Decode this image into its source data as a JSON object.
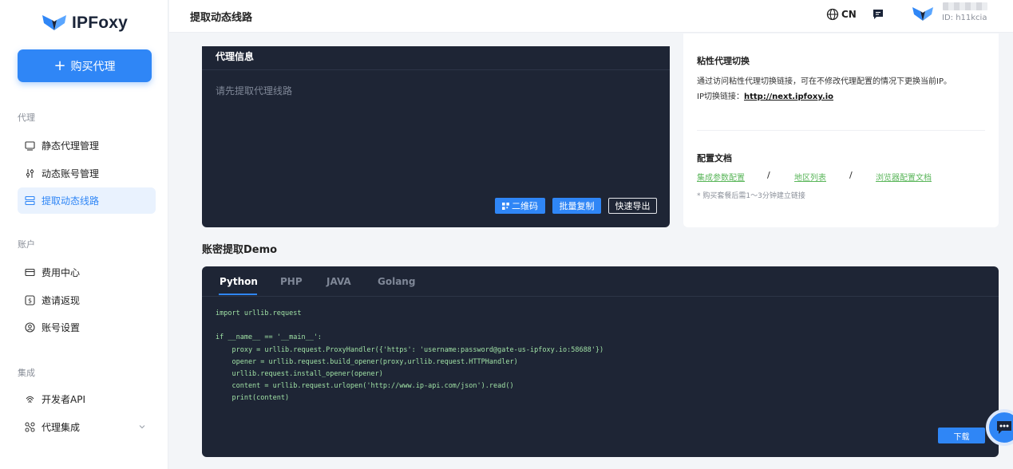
{
  "brand": {
    "name": "IPFoxy"
  },
  "sidebar": {
    "buy_button": "购买代理",
    "groups": [
      {
        "label": "代理",
        "items": [
          {
            "label": "静态代理管理",
            "icon": "monitor-icon"
          },
          {
            "label": "动态账号管理",
            "icon": "sliders-icon"
          },
          {
            "label": "提取动态线路",
            "icon": "server-icon",
            "active": true
          }
        ]
      },
      {
        "label": "账户",
        "items": [
          {
            "label": "费用中心",
            "icon": "card-icon"
          },
          {
            "label": "邀请返现",
            "icon": "dollar-icon"
          },
          {
            "label": "账号设置",
            "icon": "user-circle-icon"
          }
        ]
      },
      {
        "label": "集成",
        "items": [
          {
            "label": "开发者API",
            "icon": "fingerprint-icon"
          },
          {
            "label": "代理集成",
            "icon": "integration-icon"
          }
        ]
      }
    ]
  },
  "header": {
    "title": "提取动态线路",
    "lang": "CN",
    "user_id": "ID: h11kcia"
  },
  "proxy_info": {
    "title": "代理信息",
    "placeholder": "请先提取代理线路",
    "qr_button": "二维码",
    "batch_copy_button": "批量复制",
    "export_button": "快速导出"
  },
  "sticky": {
    "title": "粘性代理切换",
    "desc": "通过访问粘性代理切换链接，可在不修改代理配置的情况下更换当前IP。",
    "link_label": "IP切换链接：",
    "link": "http://next.ipfoxy.io"
  },
  "docs": {
    "title": "配置文档",
    "links": [
      "集成参数配置",
      "地区列表",
      "浏览器配置文档"
    ],
    "separator": "/",
    "note": "* 购买套餐后需1～3分钟建立链接"
  },
  "demo": {
    "title": "账密提取Demo",
    "tabs": [
      "Python",
      "PHP",
      "JAVA",
      "Golang"
    ],
    "active_tab": "Python",
    "code": "import urllib.request\n\nif __name__ == '__main__':\n    proxy = urllib.request.ProxyHandler({'https': 'username:password@gate-us-ipfoxy.io:58688'})\n    opener = urllib.request.build_opener(proxy,urllib.request.HTTPHandler)\n    urllib.request.install_opener(opener)\n    content = urllib.request.urlopen('http://www.ip-api.com/json').read()\n    print(content)",
    "download_button": "下载"
  },
  "colors": {
    "accent": "#2f86f6",
    "dark_panel": "#1e2535",
    "code_text": "#9fe0a4",
    "doc_link": "#5ab65a"
  }
}
